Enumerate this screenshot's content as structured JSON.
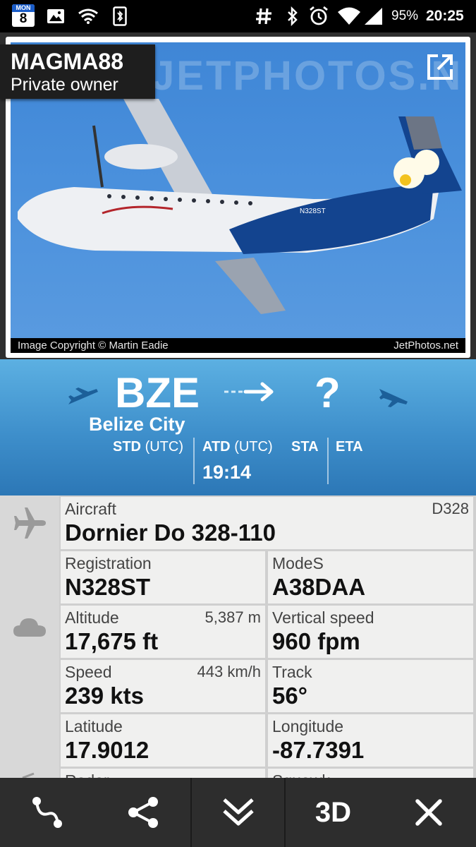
{
  "status_bar": {
    "calendar": {
      "weekday": "MON",
      "day": "8"
    },
    "battery": "95%",
    "time": "20:25",
    "icons": [
      "calendar-icon",
      "image-icon",
      "wifi-icon",
      "bluetooth-file-icon",
      "hash-icon",
      "bluetooth-icon",
      "alarm-icon",
      "wifi-signal-icon",
      "cell-signal-icon"
    ]
  },
  "flight": {
    "callsign": "MAGMA88",
    "owner": "Private owner"
  },
  "photo": {
    "watermark": "JETPHOTOS.NET",
    "copyright": "Image Copyright © Martin Eadie",
    "source": "JetPhotos.net"
  },
  "route": {
    "origin_code": "BZE",
    "origin_city": "Belize City",
    "dest_code": "?",
    "std_label": "STD",
    "atd_label": "ATD",
    "utc_label": "(UTC)",
    "sta_label": "STA",
    "eta_label": "ETA",
    "atd_value": "19:14"
  },
  "details": {
    "aircraft": {
      "label": "Aircraft",
      "value": "Dornier Do 328-110",
      "code": "D328"
    },
    "registration": {
      "label": "Registration",
      "value": "N328ST"
    },
    "modes": {
      "label": "ModeS",
      "value": "A38DAA"
    },
    "altitude": {
      "label": "Altitude",
      "value": "17,675 ft",
      "sub": "5,387 m"
    },
    "vertical_speed": {
      "label": "Vertical speed",
      "value": "960 fpm"
    },
    "speed": {
      "label": "Speed",
      "value": "239 kts",
      "sub": "443 km/h"
    },
    "track": {
      "label": "Track",
      "value": "56°"
    },
    "latitude": {
      "label": "Latitude",
      "value": "17.9012"
    },
    "longitude": {
      "label": "Longitude",
      "value": "-87.7391"
    },
    "radar": {
      "label": "Radar"
    },
    "squawk": {
      "label": "Squawk"
    }
  },
  "toolbar": {
    "label_3d": "3D"
  },
  "colors": {
    "route_blue": "#3e8fcb",
    "toolbar_bg": "#2d2d2d",
    "cell_bg": "#f0f0ef"
  }
}
